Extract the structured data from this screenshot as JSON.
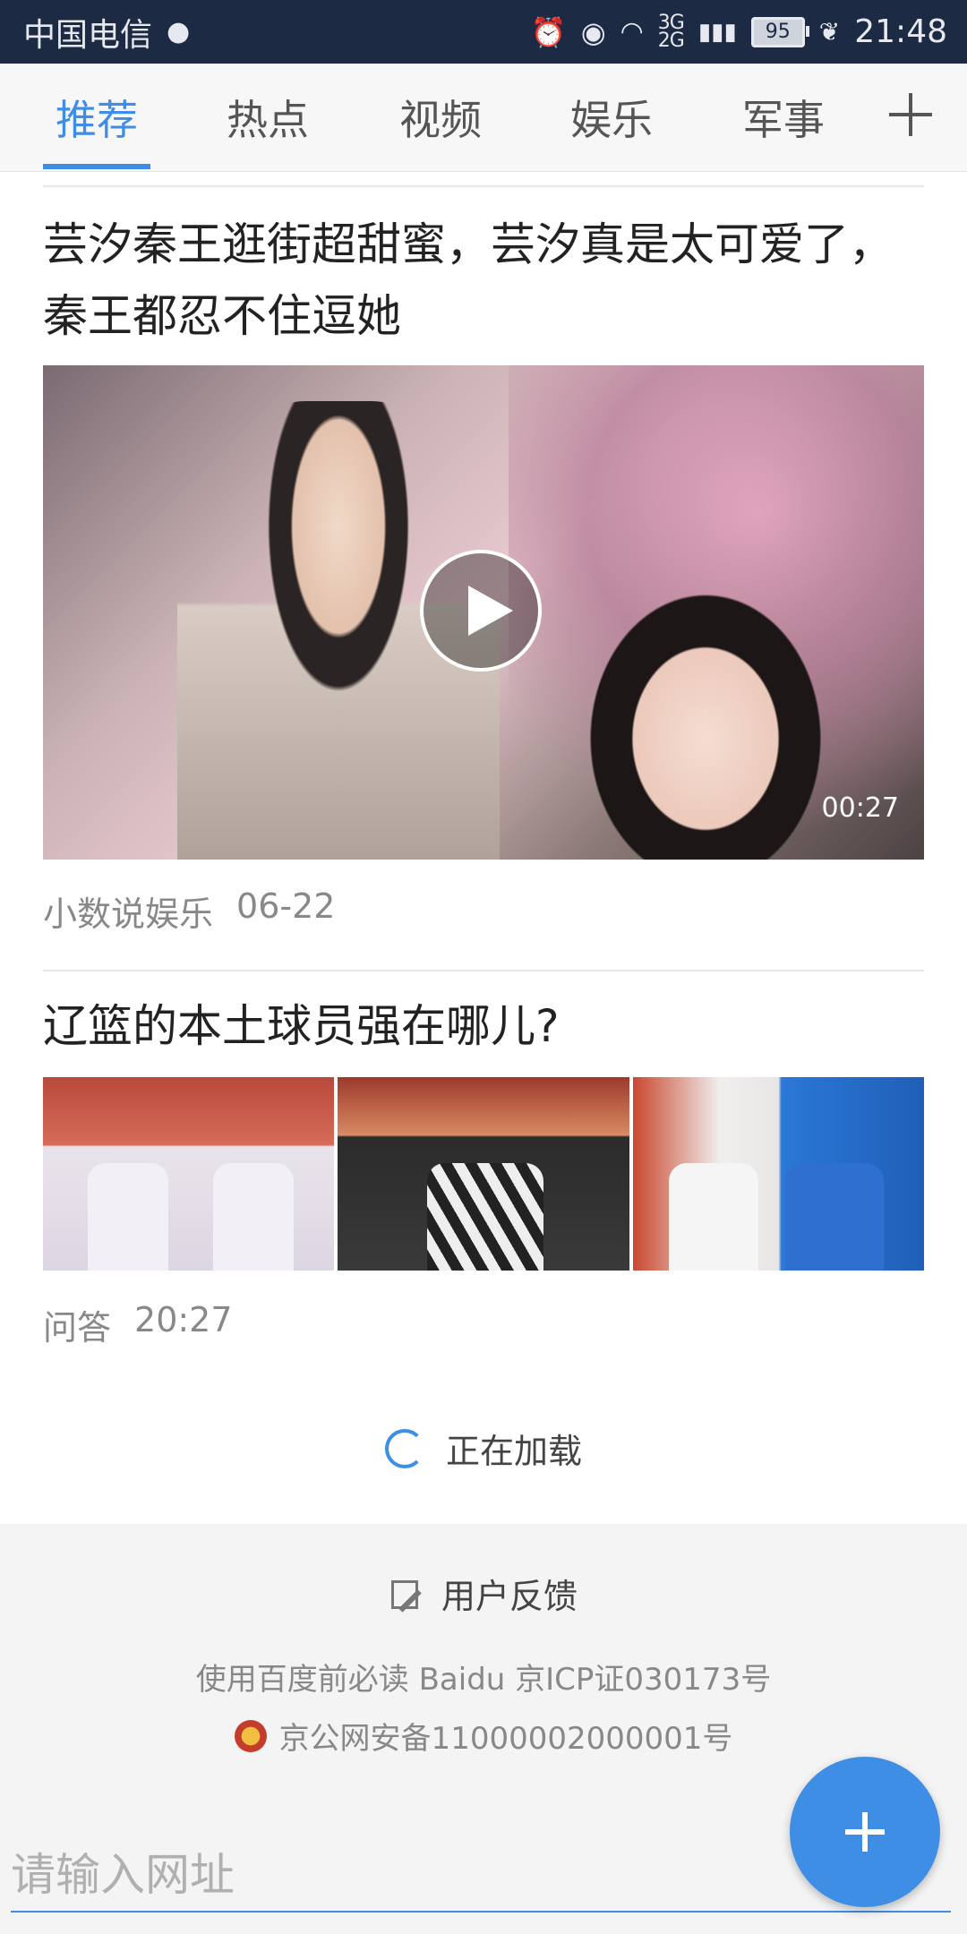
{
  "status_bar": {
    "carrier": "中国电信",
    "network_top": "3G",
    "network_bottom": "2G",
    "battery": "95",
    "time": "21:48"
  },
  "tabs": [
    {
      "label": "推荐",
      "active": true
    },
    {
      "label": "热点",
      "active": false
    },
    {
      "label": "视频",
      "active": false
    },
    {
      "label": "娱乐",
      "active": false
    },
    {
      "label": "军事",
      "active": false
    }
  ],
  "feed": [
    {
      "title": "芸汐秦王逛街超甜蜜，芸汐真是太可爱了，秦王都忍不住逗她",
      "type": "video",
      "duration": "00:27",
      "source": "小数说娱乐",
      "date": "06-22"
    },
    {
      "title": "辽篮的本土球员强在哪儿?",
      "type": "images",
      "source": "问答",
      "date": "20:27"
    }
  ],
  "loading_text": "正在加载",
  "footer": {
    "feedback": "用户反馈",
    "line1": "使用百度前必读 Baidu 京ICP证030173号",
    "line2": "京公网安备11000002000001号"
  },
  "url_bar": {
    "placeholder": "请输入网址"
  },
  "colors": {
    "accent": "#3f8ee6",
    "status_bar_bg": "#1d2a44"
  }
}
